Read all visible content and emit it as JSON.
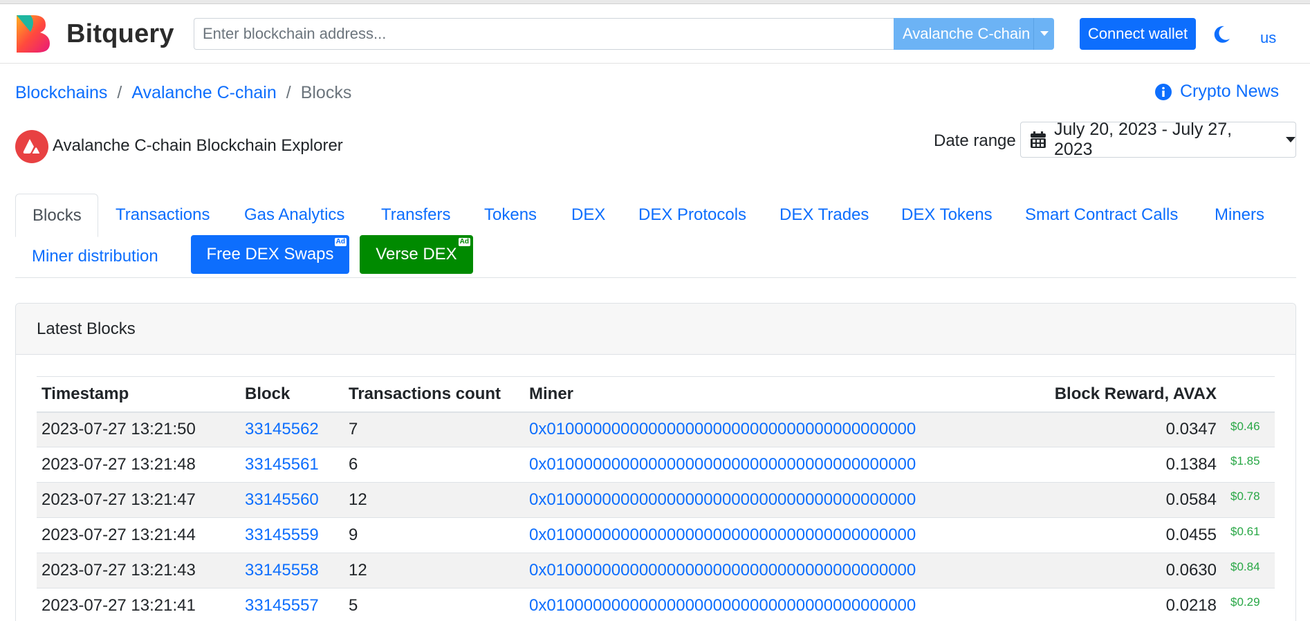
{
  "header": {
    "brand": "Bitquery",
    "search_placeholder": "Enter blockchain address...",
    "chain_selected": "Avalanche C-chain",
    "connect_label": "Connect wallet",
    "lang": "us",
    "accent_color": "#0d6efd"
  },
  "breadcrumb": {
    "items": [
      "Blockchains",
      "Avalanche C-chain"
    ],
    "current": "Blocks",
    "separator": "/"
  },
  "crypto_news": "Crypto News",
  "explorer": {
    "title": "Avalanche C-chain Blockchain Explorer",
    "date_label": "Date range",
    "date_value": "July 20, 2023 - July 27, 2023"
  },
  "tabs": [
    {
      "label": "Blocks",
      "active": true
    },
    {
      "label": "Transactions"
    },
    {
      "label": "Gas Analytics"
    },
    {
      "label": "Transfers"
    },
    {
      "label": "Tokens"
    },
    {
      "label": "DEX"
    },
    {
      "label": "DEX Protocols"
    },
    {
      "label": "DEX Trades"
    },
    {
      "label": "DEX Tokens"
    },
    {
      "label": "Smart Contract Calls"
    },
    {
      "label": "Miners"
    },
    {
      "label": "Miner distribution"
    }
  ],
  "ad_buttons": [
    {
      "label": "Free DEX Swaps",
      "badge": "Ad",
      "color": "#0d6efd"
    },
    {
      "label": "Verse DEX",
      "badge": "Ad",
      "color": "#008a00"
    }
  ],
  "card": {
    "title": "Latest Blocks",
    "columns": [
      "Timestamp",
      "Block",
      "Transactions count",
      "Miner",
      "Block Reward, AVAX"
    ],
    "rows": [
      {
        "timestamp": "2023-07-27 13:21:50",
        "block": "33145562",
        "tx": "7",
        "miner": "0x0100000000000000000000000000000000000000",
        "reward": "0.0347",
        "usd": "$0.46"
      },
      {
        "timestamp": "2023-07-27 13:21:48",
        "block": "33145561",
        "tx": "6",
        "miner": "0x0100000000000000000000000000000000000000",
        "reward": "0.1384",
        "usd": "$1.85"
      },
      {
        "timestamp": "2023-07-27 13:21:47",
        "block": "33145560",
        "tx": "12",
        "miner": "0x0100000000000000000000000000000000000000",
        "reward": "0.0584",
        "usd": "$0.78"
      },
      {
        "timestamp": "2023-07-27 13:21:44",
        "block": "33145559",
        "tx": "9",
        "miner": "0x0100000000000000000000000000000000000000",
        "reward": "0.0455",
        "usd": "$0.61"
      },
      {
        "timestamp": "2023-07-27 13:21:43",
        "block": "33145558",
        "tx": "12",
        "miner": "0x0100000000000000000000000000000000000000",
        "reward": "0.0630",
        "usd": "$0.84"
      },
      {
        "timestamp": "2023-07-27 13:21:41",
        "block": "33145557",
        "tx": "5",
        "miner": "0x0100000000000000000000000000000000000000",
        "reward": "0.0218",
        "usd": "$0.29"
      }
    ]
  }
}
